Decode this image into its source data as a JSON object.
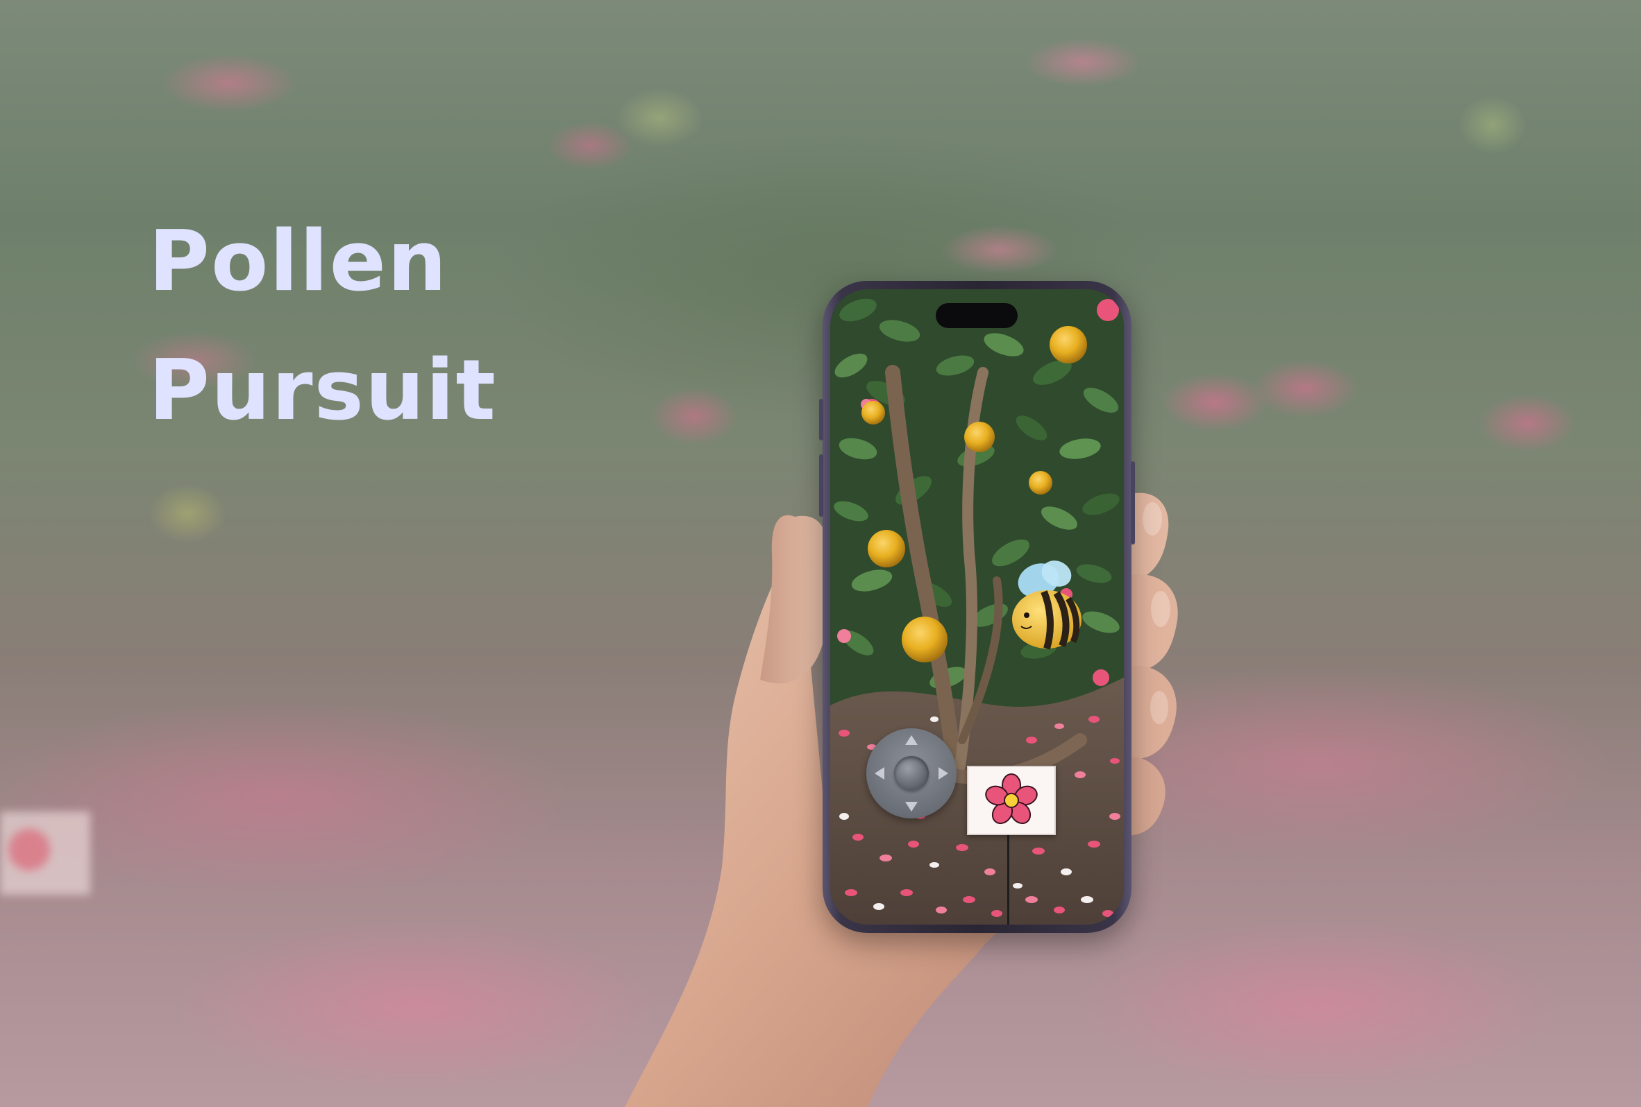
{
  "title": {
    "line1": "Pollen",
    "line2": "Pursuit"
  },
  "colors": {
    "title": "#dfe3ff",
    "pollen": "#e8b021",
    "bee_yellow": "#f2c23a",
    "bee_stripe": "#2b2116",
    "bee_wing": "#a9dcf5",
    "petals": "#e9557a",
    "dpad": "#767a82"
  },
  "game": {
    "pollen_orbs": 7,
    "controls": [
      "up",
      "down",
      "left",
      "right"
    ],
    "icons": [
      "bee-icon",
      "pollen-orb-icon",
      "dpad-icon",
      "flower-sign-icon"
    ]
  }
}
